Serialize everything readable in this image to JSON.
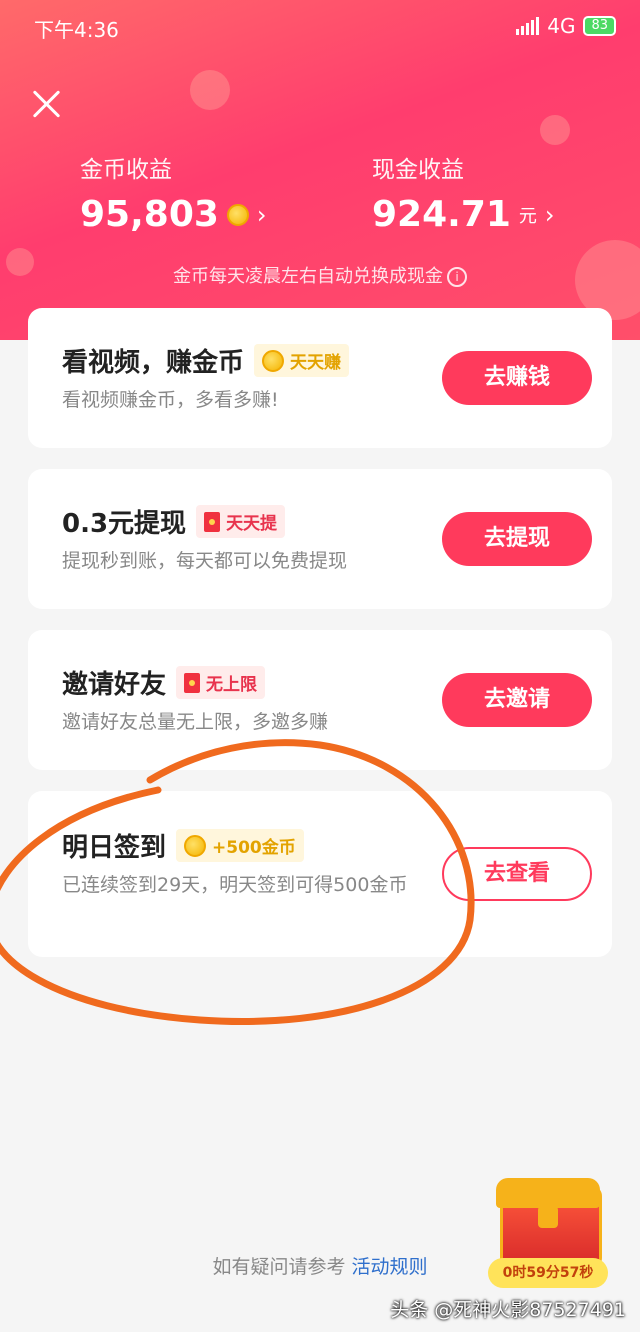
{
  "status_bar": {
    "time": "下午4:36",
    "network": "4G",
    "battery": "83"
  },
  "earnings": {
    "coin": {
      "label": "金币收益",
      "value": "95,803"
    },
    "cash": {
      "label": "现金收益",
      "value": "924.71",
      "unit": "元"
    },
    "note": "金币每天凌晨左右自动兑换成现金"
  },
  "tasks": [
    {
      "title": "看视频，赚金币",
      "tag": "天天赚",
      "tag_style": "gold",
      "desc": "看视频赚金币，多看多赚!",
      "button": "去赚钱"
    },
    {
      "title": "0.3元提现",
      "tag": "天天提",
      "tag_style": "red",
      "desc": "提现秒到账，每天都可以免费提现",
      "button": "去提现"
    },
    {
      "title": "邀请好友",
      "tag": "无上限",
      "tag_style": "red",
      "desc": "邀请好友总量无上限，多邀多赚",
      "button": "去邀请"
    },
    {
      "title": "明日签到",
      "tag": "+500金币",
      "tag_style": "gold",
      "desc": "已连续签到29天，明天签到可得500金币",
      "button": "去查看"
    }
  ],
  "footer": {
    "text": "如有疑问请参考",
    "link": "活动规则"
  },
  "treasure": {
    "timer": "0时59分57秒"
  },
  "watermark": "头条 @死神火影87527491",
  "colors": {
    "primary": "#ff3a5c",
    "annotation": "#f06a1e"
  }
}
